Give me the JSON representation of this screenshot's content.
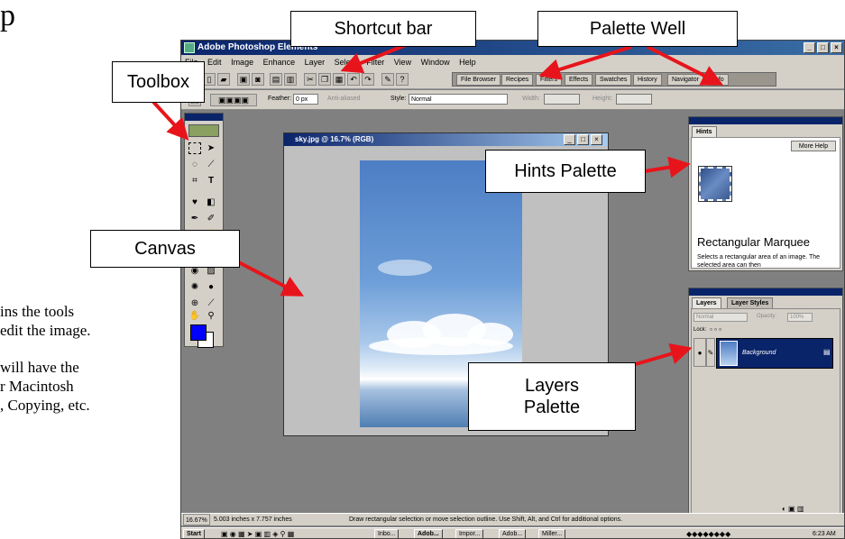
{
  "doc": {
    "title_partial": "p",
    "lines": [
      "ins the tools",
      "edit the image.",
      "will have the",
      "r Macintosh",
      ", Copying, etc."
    ]
  },
  "app": {
    "title": "Adobe Photoshop Elements",
    "menus": [
      "File",
      "Edit",
      "Image",
      "Enhance",
      "Layer",
      "Select",
      "Filter",
      "View",
      "Window",
      "Help"
    ],
    "palette_well_tabs": [
      "File Browser",
      "Recipes",
      "Filters",
      "Effects",
      "Swatches",
      "History",
      "Navigator",
      "Info"
    ]
  },
  "options": {
    "feather_label": "Feather:",
    "feather_value": "0 px",
    "anti_aliased": "Anti-aliased",
    "style_label": "Style:",
    "style_value": "Normal",
    "width_label": "Width:",
    "height_label": "Height:"
  },
  "document": {
    "title": "sky.jpg @ 16.7% (RGB)"
  },
  "hints": {
    "tab": "Hints",
    "more_help": "More Help",
    "tool_name": "Rectangular Marquee",
    "desc": "Selects a rectangular area of an image. The selected area can then"
  },
  "layers": {
    "tabs": [
      "Layers",
      "Layer Styles"
    ],
    "blend_mode": "Normal",
    "opacity_label": "Opacity:",
    "opacity_value": "100%",
    "lock_label": "Lock:",
    "layer_name": "Background"
  },
  "status": {
    "zoom": "16.67%",
    "size": "5.003 inches x 7.757 inches",
    "hint": "Draw rectangular selection or move selection outline. Use Shift, Alt, and Ctrl for additional options."
  },
  "taskbar": {
    "start": "Start",
    "items": [
      "Inbo...",
      "Adob...",
      "Impor...",
      "Adob...",
      "Miller..."
    ],
    "clock": "6:23 AM"
  },
  "callouts": {
    "toolbox": "Toolbox",
    "shortcut_bar": "Shortcut bar",
    "palette_well": "Palette Well",
    "hints_palette": "Hints Palette",
    "canvas": "Canvas",
    "layers_palette_line1": "Layers",
    "layers_palette_line2": "Palette"
  },
  "colors": {
    "foreground": "#0000ff",
    "background": "#ffffff",
    "arrow": "#e8141b"
  }
}
